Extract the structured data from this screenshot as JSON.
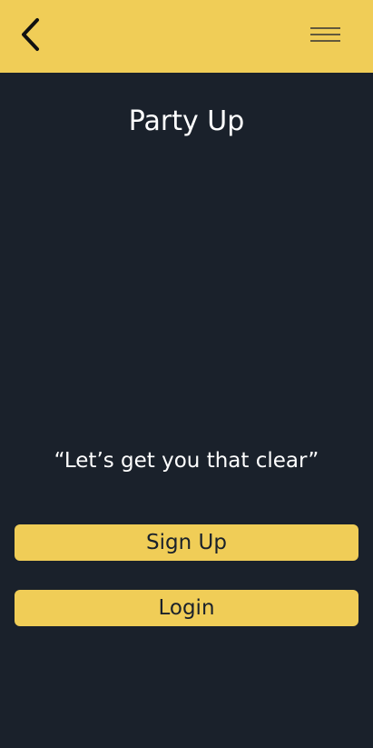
{
  "header": {
    "back_icon": "chevron-left-icon",
    "menu_icon": "hamburger-menu-icon"
  },
  "main": {
    "title": "Party Up",
    "tagline": "“Let’s get you that clear”"
  },
  "actions": {
    "signup_label": "Sign Up",
    "login_label": "Login"
  },
  "colors": {
    "background": "#1a212b",
    "accent": "#f0cd57",
    "text_on_dark": "#ffffff",
    "text_on_accent": "#1a212b"
  }
}
